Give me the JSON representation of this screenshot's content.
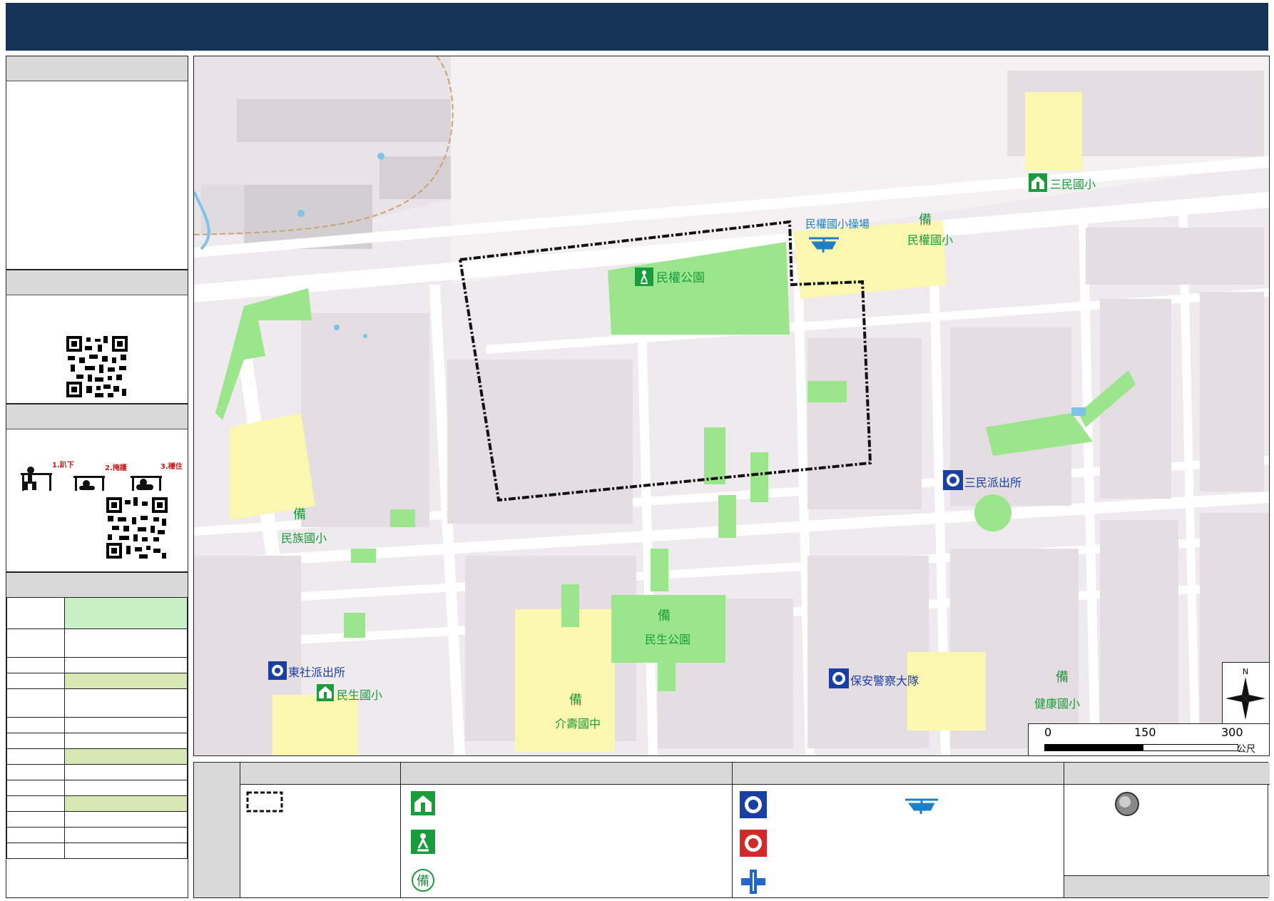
{
  "colors": {
    "header": "#153458",
    "school_fill": "#fbf6b0",
    "park_fill": "#9be58c",
    "block_fill": "#e4dde2",
    "road_fill": "#ffffff",
    "label_green": "#1a9b3c",
    "label_blue": "#1f7fc4",
    "table_green": "#c9efc5",
    "table_olive": "#d7e8b6",
    "police_blue": "#1a3fa3",
    "fire_red": "#d12a2a",
    "medical_blue": "#2166cc"
  },
  "map": {
    "poi_labels": {
      "minquan_park": "民權公園",
      "minquan_playground": "民權國小操場",
      "minquan_elementary": "民權國小",
      "sanmin_elementary": "三民國小",
      "minzu_elementary": "民族國小",
      "sanmin_police": "三民派出所",
      "dongshe_police": "東社派出所",
      "minsheng_elementary": "民生國小",
      "minsheng_park": "民生公園",
      "jieshou_junior_high": "介壽國中",
      "baoan_police": "保安警察大隊",
      "jiankang_elementary": "健康國小",
      "reserve_glyph": "備"
    },
    "icons": [
      "evacuation-shelter-icon",
      "outdoor-refuge-icon",
      "reserve-shelter-icon",
      "police-icon",
      "helipad-icon"
    ],
    "scale": {
      "ticks": [
        "0",
        "150",
        "300"
      ],
      "unit": "公尺"
    },
    "compass": {
      "north": "N"
    }
  },
  "left_panel": {
    "icons": [
      "drop-cover-hold-illustration",
      "qr-code-icon"
    ],
    "earthquake_steps": [
      "1.趴下",
      "2.掩護",
      "3.穩住"
    ]
  },
  "legend": {
    "columns": [
      {
        "icons": [
          "boundary-dashed-icon"
        ]
      },
      {
        "icons": [
          "evacuation-shelter-icon",
          "outdoor-refuge-icon",
          "reserve-shelter-icon"
        ]
      },
      {
        "icons": [
          "police-icon",
          "helipad-icon",
          "fire-station-icon",
          "medical-icon"
        ]
      },
      {
        "icons": [
          "gathering-point-icon"
        ]
      }
    ]
  }
}
